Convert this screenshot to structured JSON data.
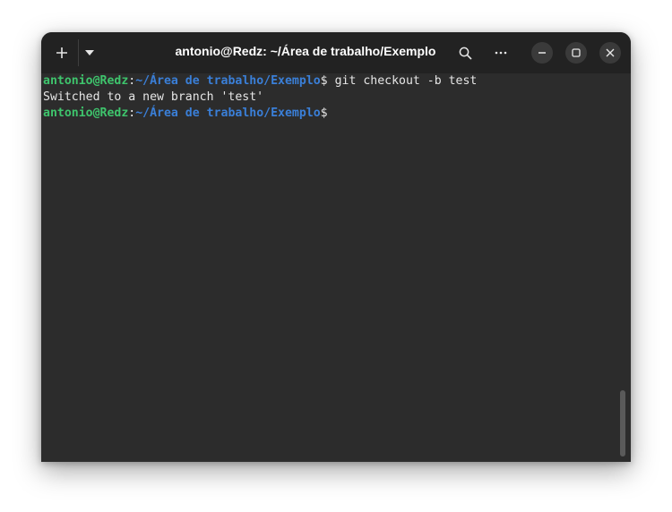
{
  "window": {
    "title": "antonio@Redz: ~/Área de trabalho/Exemplo"
  },
  "toolbar": {
    "new_tab_icon": "plus-icon",
    "menu_icon": "triangle-down-icon",
    "search_icon": "search-icon",
    "more_icon": "ellipsis-icon",
    "minimize_icon": "minimize-icon",
    "maximize_icon": "maximize-icon",
    "close_icon": "close-icon"
  },
  "terminal": {
    "lines": [
      {
        "user": "antonio@Redz",
        "sep": ":",
        "path": "~/Área de trabalho/Exemplo",
        "dollar": "$",
        "command": " git checkout -b test"
      },
      {
        "output": "Switched to a new branch 'test'"
      },
      {
        "user": "antonio@Redz",
        "sep": ":",
        "path": "~/Área de trabalho/Exemplo",
        "dollar": "$",
        "command": ""
      }
    ]
  },
  "colors": {
    "titlebar_bg": "#222222",
    "terminal_bg": "#2c2c2c",
    "prompt_user": "#3ec46c",
    "prompt_path": "#3a7fd8",
    "text": "#e6e6e6"
  }
}
